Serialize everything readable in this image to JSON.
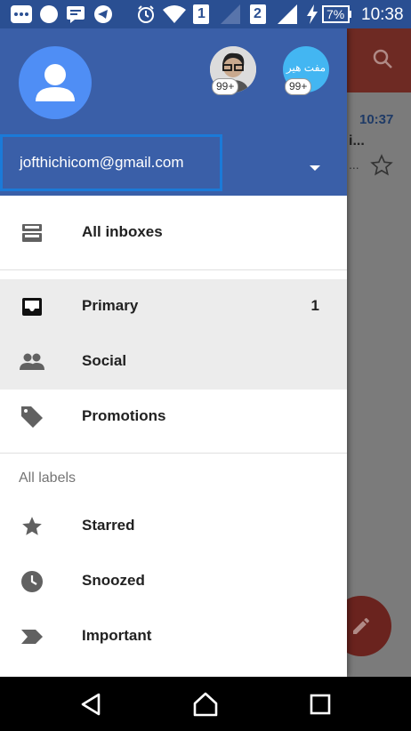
{
  "status_bar": {
    "battery_percent": "7%",
    "time": "10:38",
    "sim_labels": [
      "1",
      "2"
    ],
    "icons": [
      "bbm-icon",
      "circle-icon",
      "chat-icon",
      "telegram-icon",
      "alarm-icon",
      "wifi-icon",
      "signal-icon",
      "signal-icon",
      "charging-icon",
      "battery-icon"
    ]
  },
  "background_app": {
    "time": "10:37",
    "snippet": "i...",
    "snippet_sub": "..."
  },
  "drawer": {
    "account_email": "jofthichicom@gmail.com",
    "account_badges": [
      "99+",
      "99+"
    ],
    "account_avatar_text": "مفت هير",
    "menu": [
      {
        "label": "All inboxes",
        "icon": "all-inboxes-icon",
        "count": ""
      },
      {
        "label": "Primary",
        "icon": "inbox-icon",
        "count": "1"
      },
      {
        "label": "Social",
        "icon": "people-icon",
        "count": ""
      },
      {
        "label": "Promotions",
        "icon": "tag-icon",
        "count": ""
      }
    ],
    "labels_header": "All labels",
    "labels": [
      {
        "label": "Starred",
        "icon": "star-icon"
      },
      {
        "label": "Snoozed",
        "icon": "clock-icon"
      },
      {
        "label": "Important",
        "icon": "important-icon"
      }
    ]
  },
  "colors": {
    "header": "#3a5fa8",
    "status_bar": "#2a4f92",
    "avatar": "#4f8ef5",
    "selected_row": "#ececec",
    "focus_outline": "#1b7ad8"
  }
}
